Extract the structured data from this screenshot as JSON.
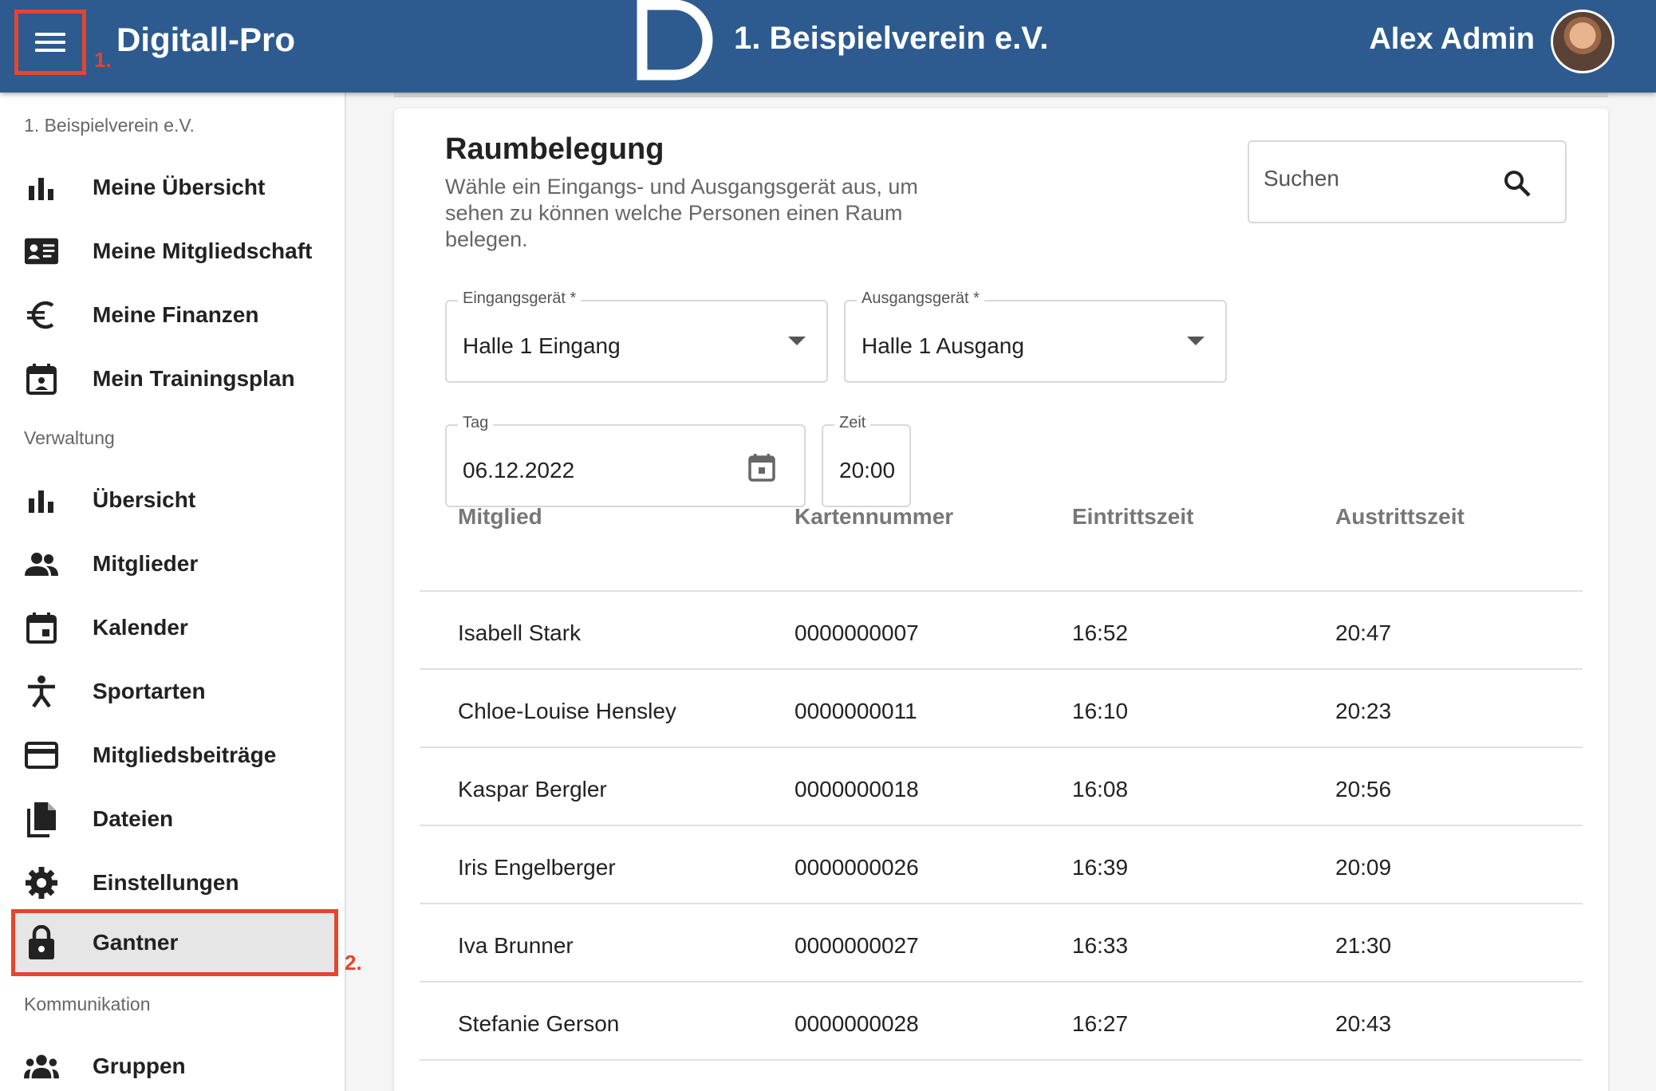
{
  "header": {
    "brand": "Digitall-Pro",
    "club_name": "1. Beispielverein e.V.",
    "user_name": "Alex Admin",
    "annotation_1": "1.",
    "annotation_2": "2."
  },
  "sidebar": {
    "club_label": "1. Beispielverein e.V.",
    "personal_items": [
      {
        "label": "Meine Übersicht",
        "icon": "bar-chart-icon"
      },
      {
        "label": "Meine Mitgliedschaft",
        "icon": "id-card-icon"
      },
      {
        "label": "Meine Finanzen",
        "icon": "euro-icon"
      },
      {
        "label": "Mein Trainingsplan",
        "icon": "calendar-person-icon"
      }
    ],
    "admin_label": "Verwaltung",
    "admin_items": [
      {
        "label": "Übersicht",
        "icon": "bar-chart-icon"
      },
      {
        "label": "Mitglieder",
        "icon": "people-icon"
      },
      {
        "label": "Kalender",
        "icon": "calendar-icon"
      },
      {
        "label": "Sportarten",
        "icon": "sports-icon"
      },
      {
        "label": "Mitgliedsbeiträge",
        "icon": "credit-card-icon"
      },
      {
        "label": "Dateien",
        "icon": "files-icon"
      },
      {
        "label": "Einstellungen",
        "icon": "gear-icon"
      },
      {
        "label": "Gantner",
        "icon": "lock-icon",
        "active": true
      }
    ],
    "comm_label": "Kommunikation",
    "comm_items": [
      {
        "label": "Gruppen",
        "icon": "groups-icon"
      }
    ]
  },
  "main": {
    "title": "Raumbelegung",
    "subtitle": "Wähle ein Eingangs- und Ausgangsgerät aus, um sehen zu können welche Personen einen Raum belegen.",
    "search_placeholder": "Suchen",
    "entry_device": {
      "label": "Eingangsgerät *",
      "value": "Halle 1 Eingang"
    },
    "exit_device": {
      "label": "Ausgangsgerät *",
      "value": "Halle 1 Ausgang"
    },
    "day": {
      "label": "Tag",
      "value": "06.12.2022"
    },
    "time": {
      "label": "Zeit",
      "value": "20:00"
    },
    "table": {
      "columns": [
        "Mitglied",
        "Kartennummer",
        "Eintrittszeit",
        "Austrittszeit"
      ],
      "rows": [
        [
          "Isabell Stark",
          "0000000007",
          "16:52",
          "20:47"
        ],
        [
          "Chloe-Louise Hensley",
          "0000000011",
          "16:10",
          "20:23"
        ],
        [
          "Kaspar Bergler",
          "0000000018",
          "16:08",
          "20:56"
        ],
        [
          "Iris Engelberger",
          "0000000026",
          "16:39",
          "20:09"
        ],
        [
          "Iva Brunner",
          "0000000027",
          "16:33",
          "21:30"
        ],
        [
          "Stefanie Gerson",
          "0000000028",
          "16:27",
          "20:43"
        ]
      ]
    }
  }
}
